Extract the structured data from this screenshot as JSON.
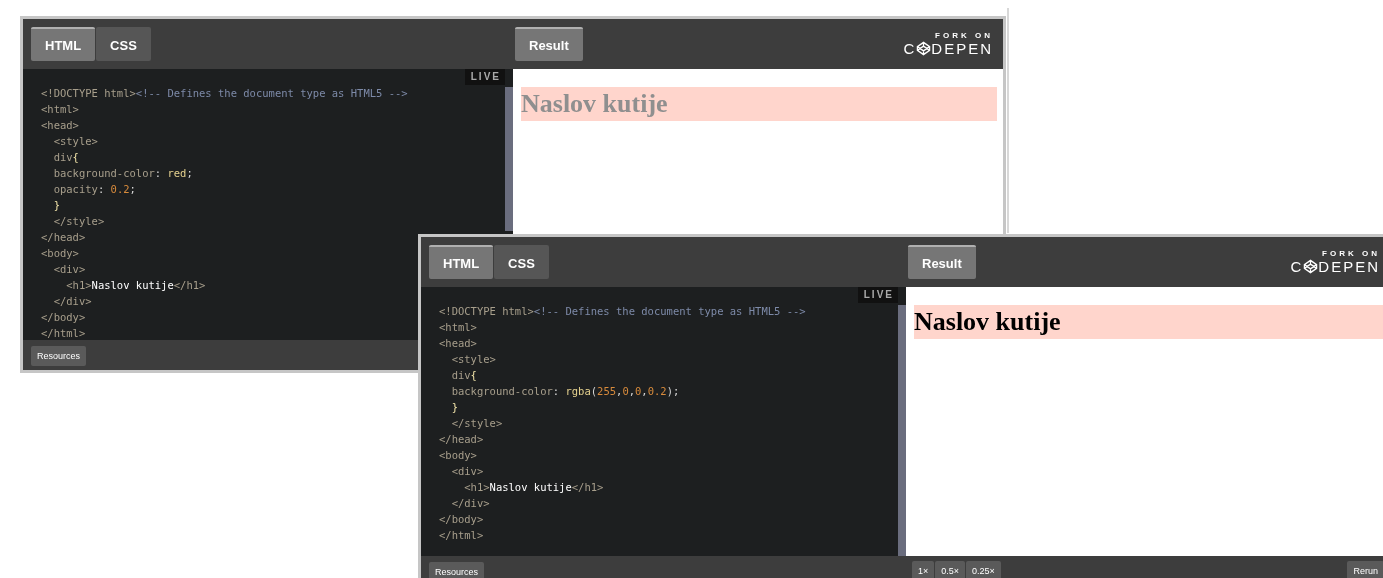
{
  "embeds": [
    {
      "tabs": [
        {
          "label": "HTML",
          "selected": true
        },
        {
          "label": "CSS",
          "selected": false
        }
      ],
      "result_tab": {
        "label": "Result",
        "selected": true
      },
      "logo": {
        "caption": "FORK ON",
        "left": "C",
        "right": "DEPEN"
      },
      "live_badge": "LIVE",
      "code_lines": [
        [
          {
            "kind": "tag",
            "text": "<!DOCTYPE html>"
          },
          {
            "kind": "comment",
            "text": "<!-- Defines the document type as HTML5 -->"
          }
        ],
        [
          {
            "kind": "tag",
            "text": "<html>"
          }
        ],
        [
          {
            "kind": "tag",
            "text": "<head>"
          }
        ],
        [
          {
            "kind": "tag",
            "text": "  <style>"
          }
        ],
        [
          {
            "kind": "tag",
            "text": "  div"
          },
          {
            "kind": "brace",
            "text": "{"
          }
        ],
        [
          {
            "kind": "prop",
            "text": "  background-color"
          },
          {
            "kind": "punct",
            "text": ": "
          },
          {
            "kind": "value",
            "text": "red"
          },
          {
            "kind": "punct",
            "text": ";"
          }
        ],
        [
          {
            "kind": "prop",
            "text": "  opacity"
          },
          {
            "kind": "punct",
            "text": ": "
          },
          {
            "kind": "number",
            "text": "0.2"
          },
          {
            "kind": "punct",
            "text": ";"
          }
        ],
        [
          {
            "kind": "brace",
            "text": "  }"
          }
        ],
        [
          {
            "kind": "tag",
            "text": "  </style>"
          }
        ],
        [
          {
            "kind": "tag",
            "text": "</head>"
          }
        ],
        [
          {
            "kind": "tag",
            "text": "<body>"
          }
        ],
        [
          {
            "kind": "tag",
            "text": "  <div>"
          }
        ],
        [
          {
            "kind": "tag",
            "text": "    <h1>"
          },
          {
            "kind": "text",
            "text": "Naslov kutije"
          },
          {
            "kind": "tag",
            "text": "</h1>"
          }
        ],
        [
          {
            "kind": "tag",
            "text": "  </div>"
          }
        ],
        [
          {
            "kind": "tag",
            "text": "</body>"
          }
        ],
        [
          {
            "kind": "tag",
            "text": "</html>"
          }
        ]
      ],
      "result": {
        "heading": "Naslov kutije",
        "faded": true
      },
      "footer_left": [
        "Resources"
      ]
    },
    {
      "tabs": [
        {
          "label": "HTML",
          "selected": true
        },
        {
          "label": "CSS",
          "selected": false
        }
      ],
      "result_tab": {
        "label": "Result",
        "selected": true
      },
      "logo": {
        "caption": "FORK ON",
        "left": "C",
        "right": "DEPEN"
      },
      "live_badge": "LIVE",
      "code_lines": [
        [
          {
            "kind": "tag",
            "text": "<!DOCTYPE html>"
          },
          {
            "kind": "comment",
            "text": "<!-- Defines the document type as HTML5 -->"
          }
        ],
        [
          {
            "kind": "tag",
            "text": "<html>"
          }
        ],
        [
          {
            "kind": "tag",
            "text": "<head>"
          }
        ],
        [
          {
            "kind": "tag",
            "text": "  <style>"
          }
        ],
        [
          {
            "kind": "tag",
            "text": "  div"
          },
          {
            "kind": "brace",
            "text": "{"
          }
        ],
        [
          {
            "kind": "prop",
            "text": "  background-color"
          },
          {
            "kind": "punct",
            "text": ": "
          },
          {
            "kind": "value",
            "text": "rgba"
          },
          {
            "kind": "punct",
            "text": "("
          },
          {
            "kind": "number",
            "text": "255"
          },
          {
            "kind": "punct",
            "text": ","
          },
          {
            "kind": "number",
            "text": "0"
          },
          {
            "kind": "punct",
            "text": ","
          },
          {
            "kind": "number",
            "text": "0"
          },
          {
            "kind": "punct",
            "text": ","
          },
          {
            "kind": "number",
            "text": "0.2"
          },
          {
            "kind": "punct",
            "text": ");"
          }
        ],
        [
          {
            "kind": "brace",
            "text": "  }"
          }
        ],
        [
          {
            "kind": "tag",
            "text": "  </style>"
          }
        ],
        [
          {
            "kind": "tag",
            "text": "</head>"
          }
        ],
        [
          {
            "kind": "tag",
            "text": "<body>"
          }
        ],
        [
          {
            "kind": "tag",
            "text": "  <div>"
          }
        ],
        [
          {
            "kind": "tag",
            "text": "    <h1>"
          },
          {
            "kind": "text",
            "text": "Naslov kutije"
          },
          {
            "kind": "tag",
            "text": "</h1>"
          }
        ],
        [
          {
            "kind": "tag",
            "text": "  </div>"
          }
        ],
        [
          {
            "kind": "tag",
            "text": "</body>"
          }
        ],
        [
          {
            "kind": "tag",
            "text": "</html>"
          }
        ]
      ],
      "result": {
        "heading": "Naslov kutije",
        "faded": false
      },
      "footer_left": [
        "Resources"
      ],
      "zoom_buttons": [
        "1×",
        "0.5×",
        "0.25×"
      ],
      "rerun": "Rerun"
    }
  ]
}
